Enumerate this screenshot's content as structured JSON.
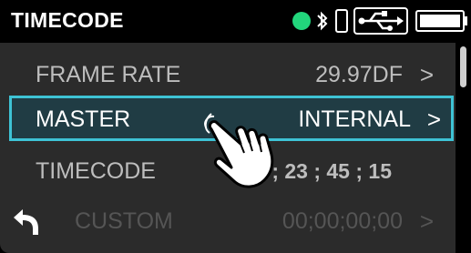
{
  "header": {
    "title": "TIMECODE",
    "status_dot_color": "#22d67c",
    "icons": [
      "bluetooth-icon",
      "phone-icon",
      "usb-icon",
      "battery-icon"
    ]
  },
  "menu": {
    "items": [
      {
        "label": "FRAME RATE",
        "value": "29.97DF",
        "chevron": ">"
      },
      {
        "label": "MASTER",
        "value": "INTERNAL",
        "chevron": ">",
        "selected": true
      },
      {
        "label": "TIMECODE",
        "value": "01 ; 23 ; 45 ; 15"
      },
      {
        "label": "CUSTOM",
        "value": "00;00;00;00",
        "chevron": ">",
        "disabled": true
      }
    ]
  },
  "colors": {
    "highlight_border": "#3ec3d5",
    "highlight_fill": "#203c44",
    "row_background": "#2b2b2b"
  }
}
